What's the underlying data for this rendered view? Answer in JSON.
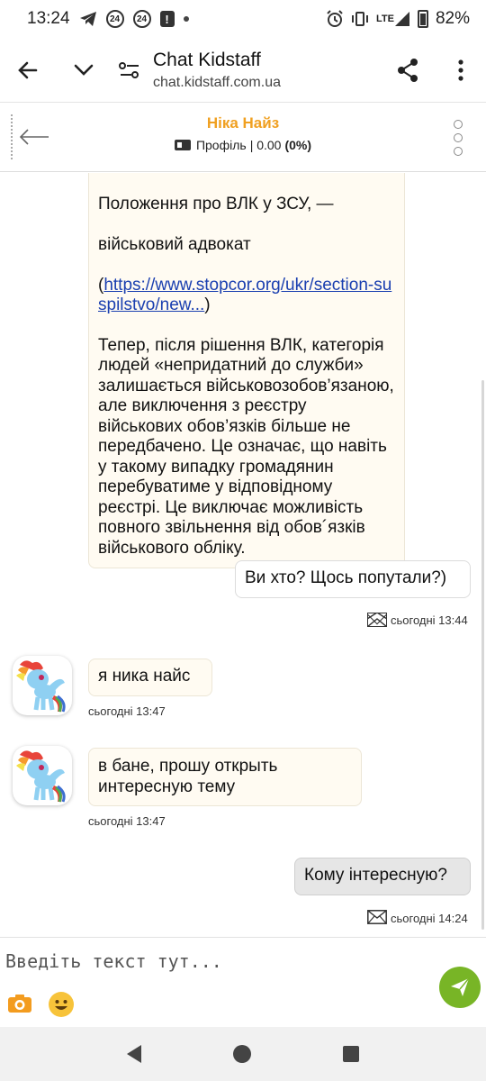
{
  "status_bar": {
    "time": "13:24",
    "badge_1": "24",
    "badge_2": "24",
    "alert": "!",
    "network": "LTE",
    "battery": "82%"
  },
  "browser": {
    "title": "Chat Kidstaff",
    "url": "chat.kidstaff.com.ua"
  },
  "chat_header": {
    "name": "Ніка Найз",
    "profile_label": "Профіль",
    "rating": "| 0.00",
    "rating_percent": "(0%)"
  },
  "messages": [
    {
      "direction": "incoming",
      "paragraph_1_line_1": "Положення про ВЛК у ЗСУ, —",
      "paragraph_1_line_2": "військовий адвокат",
      "link_open": "(",
      "link_text": "https://www.stopcor.org/ukr/section-suspilstvo/new...",
      "link_close": ")",
      "paragraph_2": "Тепер, після рішення ВЛК, категорія людей «непридатний до служби» залишається військовозобов’язаною, але виключення з реєстру військових обов’язків більше не передбачено. Це означає, що навіть у такому випадку громадянин перебуватиме у відповідному реєстрі. Це виключає можливість повного звільнення від обов´язків військового обліку."
    },
    {
      "direction": "outgoing",
      "text": "Ви хто? Щось попутали?)",
      "time": "сьогодні 13:44"
    },
    {
      "direction": "incoming",
      "text": "я ника найс",
      "time": "сьогодні 13:47"
    },
    {
      "direction": "incoming",
      "text": "в бане, прошу открыть интересную тему",
      "time": "сьогодні 13:47"
    },
    {
      "direction": "outgoing",
      "text": "Кому інтересную?",
      "time": "сьогодні 14:24"
    }
  ],
  "composer": {
    "placeholder": "Введіть текст тут..."
  },
  "colors": {
    "accent": "#f0a021",
    "send": "#78b526",
    "link": "#1a3fb0"
  }
}
